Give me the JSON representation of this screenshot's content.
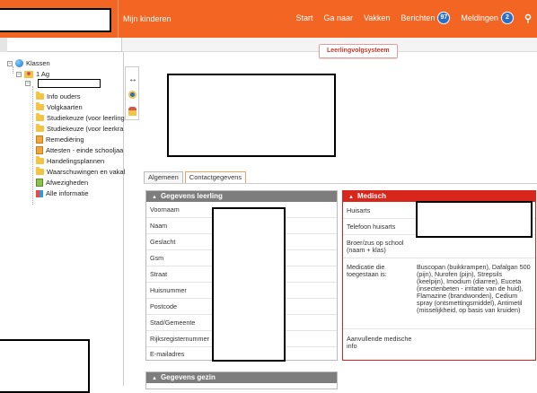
{
  "topbar": {
    "brand": "Mijn kinderen",
    "nav": [
      {
        "label": "Start"
      },
      {
        "label": "Ga naar"
      },
      {
        "label": "Vakken"
      },
      {
        "label": "Berichten",
        "badge": "97"
      },
      {
        "label": "Meldingen",
        "badge": "2"
      }
    ]
  },
  "module_tab": "Leerlingvolgsysteem",
  "tree": {
    "root": "Klassen",
    "class": "1 Ag",
    "items": [
      "Info ouders",
      "Volgkaarten",
      "Studiekeuze (voor leerling",
      "Studiekeuze (voor leerkra",
      "Remediëring",
      "Attesten - einde schooljaa",
      "Handelingsplannen",
      "Waarschuwingen en vakal",
      "Afwezigheden",
      "Alle informatie"
    ]
  },
  "tabs": [
    "Algemeen",
    "Contactgegevens"
  ],
  "student_panel": {
    "title": "Gegevens leerling",
    "fields": [
      "Voornaam",
      "Naam",
      "Geslacht",
      "Gsm",
      "Straat",
      "Huisnummer",
      "Postcode",
      "Stad/Gemeente",
      "Rijksregisternummer",
      "E-mailadres"
    ]
  },
  "medical_panel": {
    "title": "Medisch",
    "fields": [
      {
        "label": "Huisarts",
        "value": ""
      },
      {
        "label": "Telefoon huisarts",
        "value": ""
      },
      {
        "label": "Broer/zus op school (naam + klas)",
        "value": ""
      },
      {
        "label": "Medicatie die toegestaan is:",
        "value": "Buscopan (buikkrampen), Dafalgan 500 (pijn), Nurofen (pijn), Strepsils (keelpijn), Imodium (diarree), Euceta (insectenbeten - irritatie van de huid), Flamazine (brandwonden), Cedium spray (ontsmettingsmiddel), Antimetil (misselijkheid, op basis van kruiden)"
      },
      {
        "label": "Aanvullende medische info",
        "value": ""
      }
    ]
  },
  "family_panel": {
    "title": "Gegevens gezin"
  },
  "colors": {
    "accent": "#f26522",
    "medical": "#d9261c",
    "panel_gray": "#7d7d7d",
    "badge": "#2a6ec7"
  }
}
